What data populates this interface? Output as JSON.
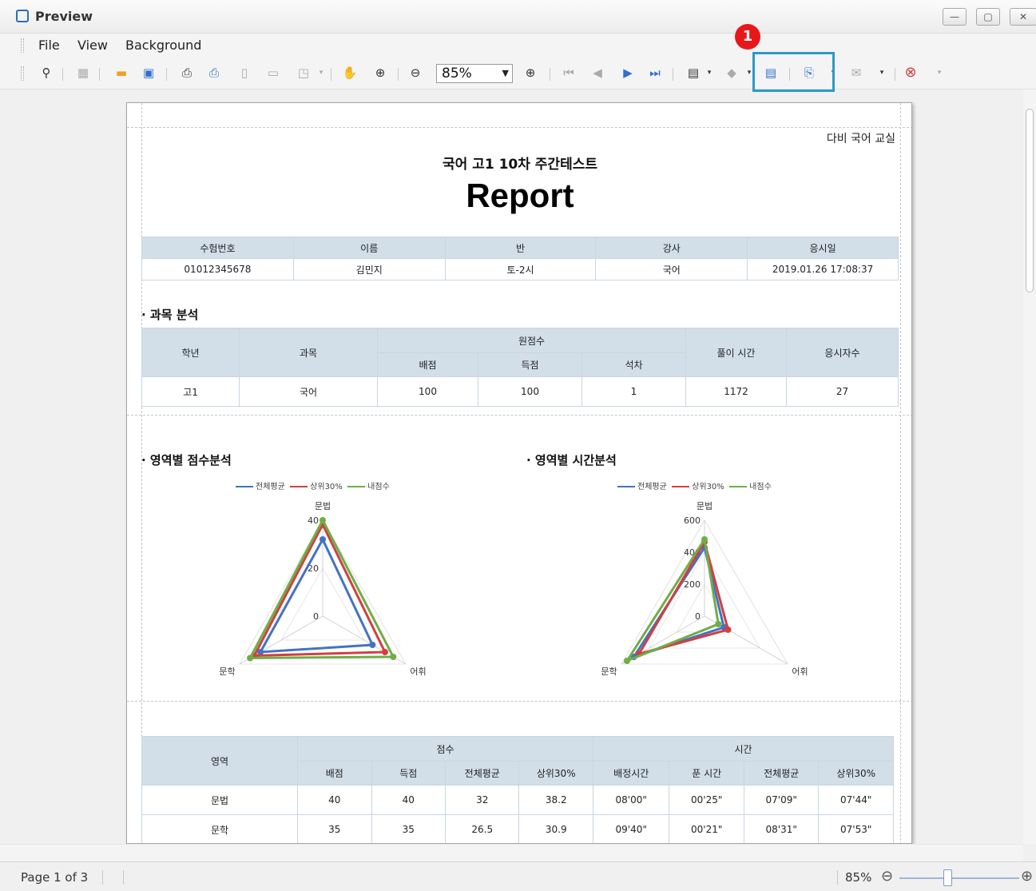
{
  "window": {
    "title": "Preview",
    "minimize": "—",
    "maximize": "▢",
    "close": "✕"
  },
  "menu": {
    "file": "File",
    "view": "View",
    "background": "Background"
  },
  "toolbar": {
    "zoom": "85%",
    "annotation_badge": "1"
  },
  "icons": {
    "find": "binoculars-icon",
    "open": "folder-icon",
    "save": "save-icon",
    "print": "printer-icon",
    "hand": "hand-icon",
    "zoom": "magnifier-icon",
    "first": "first-page-icon",
    "prev": "prev-page-icon",
    "next": "next-page-icon",
    "last": "last-page-icon",
    "export_doc": "export-document-icon",
    "export_file": "export-file-icon",
    "mail": "mail-icon",
    "close_preview": "close-preview-icon"
  },
  "colors": {
    "highlight": "#2b9bc4",
    "badge": "#e8181a",
    "header_cell": "#d2dfe9",
    "series_all": "#4472c4",
    "series_top": "#d04040",
    "series_mine": "#70ad47"
  },
  "report": {
    "academy": "다비 국어 교실",
    "test_title": "국어 고1 10차 주간테스트",
    "main_title": "Report",
    "info": {
      "headers": [
        "수험번호",
        "이름",
        "반",
        "강사",
        "응시일"
      ],
      "values": [
        "01012345678",
        "김민지",
        "토-2시",
        "국어",
        "2019.01.26 17:08:37"
      ]
    },
    "analysis": {
      "section_title": "· 과목 분석",
      "h_grade": "학년",
      "h_subject": "과목",
      "h_total": "원점수",
      "h_score_max": "배점",
      "h_score": "득점",
      "h_rank": "석차",
      "h_time": "풀이 시간",
      "h_takers": "응시자수",
      "row": {
        "grade": "고1",
        "subject": "국어",
        "max": "100",
        "score": "100",
        "rank": "1",
        "time": "1172",
        "takers": "27"
      }
    },
    "chart_left": {
      "title": "· 영역별 점수분석",
      "legend": [
        "전체평균",
        "상위30%",
        "내점수"
      ]
    },
    "chart_right": {
      "title": "· 영역별 시간분석",
      "legend": [
        "전체평균",
        "상위30%",
        "내점수"
      ]
    },
    "area_table": {
      "h_area": "영역",
      "h_score": "점수",
      "h_time": "시간",
      "sub": [
        "배점",
        "득점",
        "전체평균",
        "상위30%",
        "배정시간",
        "푼 시간",
        "전체평균",
        "상위30%"
      ],
      "rows": [
        [
          "문법",
          "40",
          "40",
          "32",
          "38.2",
          "08'00\"",
          "00'25\"",
          "07'09\"",
          "07'44\""
        ],
        [
          "문학",
          "35",
          "35",
          "26.5",
          "30.9",
          "09'40\"",
          "00'21\"",
          "08'31\"",
          "07'53\""
        ]
      ]
    }
  },
  "chart_data": [
    {
      "type": "radar",
      "title": "· 영역별 점수분석",
      "categories": [
        "문법",
        "어휘",
        "문학"
      ],
      "rlim": [
        0,
        40
      ],
      "ticks": [
        "0",
        "20",
        "40"
      ],
      "series": [
        {
          "name": "전체평균",
          "values": [
            32,
            24,
            30
          ]
        },
        {
          "name": "상위30%",
          "values": [
            38.2,
            30,
            33
          ]
        },
        {
          "name": "내점수",
          "values": [
            40,
            34,
            35
          ]
        }
      ],
      "legend": "top"
    },
    {
      "type": "radar",
      "title": "· 영역별 시간분석",
      "categories": [
        "문법",
        "어휘",
        "문학"
      ],
      "rlim": [
        0,
        600
      ],
      "ticks": [
        "0",
        "200",
        "400",
        "600"
      ],
      "series": [
        {
          "name": "전체평균",
          "values": [
            429,
            140,
            511
          ]
        },
        {
          "name": "상위30%",
          "values": [
            464,
            170,
            473
          ]
        },
        {
          "name": "내점수",
          "values": [
            480,
            100,
            560
          ]
        }
      ],
      "legend": "top"
    }
  ],
  "status": {
    "page": "Page 1 of 3",
    "zoom": "85%",
    "zoom_out": "⊖",
    "zoom_in": "⊕"
  }
}
